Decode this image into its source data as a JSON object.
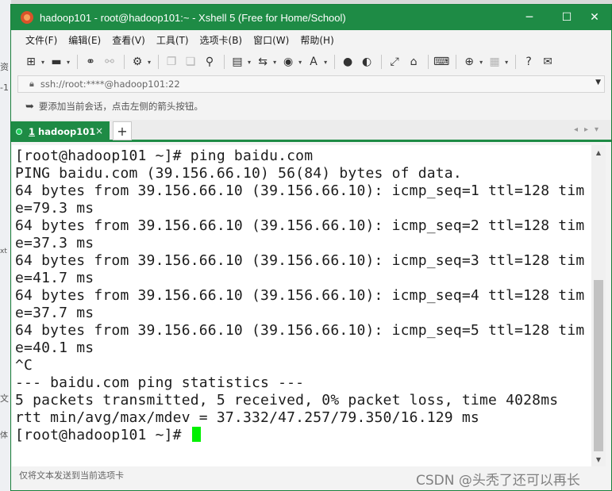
{
  "window": {
    "title": "hadoop101 - root@hadoop101:~ - Xshell 5 (Free for Home/School)",
    "controls": {
      "minimize": "─",
      "maximize": "☐",
      "close": "✕"
    }
  },
  "menu": {
    "items": [
      "文件(F)",
      "编辑(E)",
      "查看(V)",
      "工具(T)",
      "选项卡(B)",
      "窗口(W)",
      "帮助(H)"
    ]
  },
  "toolbar": {
    "icons": [
      "new-session-icon",
      "open-folder-icon",
      "reconnect-icon",
      "disconnect-icon",
      "properties-icon",
      "copy-icon",
      "paste-icon",
      "find-icon",
      "print-icon",
      "transfer-icon",
      "globe-icon",
      "font-icon",
      "xftp-icon",
      "xmanager-icon",
      "fullscreen-icon",
      "lock-icon",
      "keyboard-icon",
      "add-pane-icon",
      "layout-icon",
      "help-icon",
      "chat-icon"
    ]
  },
  "address": {
    "url": "ssh://root:****@hadoop101:22"
  },
  "hint": {
    "text": "要添加当前会话，点击左侧的箭头按钮。"
  },
  "tabs": [
    {
      "number": "1",
      "label": "hadoop101",
      "active": true
    }
  ],
  "terminal": {
    "lines": [
      "[root@hadoop101 ~]# ping baidu.com",
      "PING baidu.com (39.156.66.10) 56(84) bytes of data.",
      "64 bytes from 39.156.66.10 (39.156.66.10): icmp_seq=1 ttl=128 tim",
      "e=79.3 ms",
      "64 bytes from 39.156.66.10 (39.156.66.10): icmp_seq=2 ttl=128 tim",
      "e=37.3 ms",
      "64 bytes from 39.156.66.10 (39.156.66.10): icmp_seq=3 ttl=128 tim",
      "e=41.7 ms",
      "64 bytes from 39.156.66.10 (39.156.66.10): icmp_seq=4 ttl=128 tim",
      "e=37.7 ms",
      "64 bytes from 39.156.66.10 (39.156.66.10): icmp_seq=5 ttl=128 tim",
      "e=40.1 ms",
      "^C",
      "--- baidu.com ping statistics ---",
      "5 packets transmitted, 5 received, 0% packet loss, time 4028ms",
      "rtt min/avg/max/mdev = 37.332/47.257/79.350/16.129 ms"
    ],
    "prompt": "[root@hadoop101 ~]# ",
    "cursor_color": "#00f000"
  },
  "status": {
    "text": "仅将文本发送到当前选项卡"
  },
  "watermark": {
    "text": "CSDN @头秃了还可以再长"
  },
  "colors": {
    "accent": "#1e8b45",
    "terminal_bg": "#ffffff"
  }
}
